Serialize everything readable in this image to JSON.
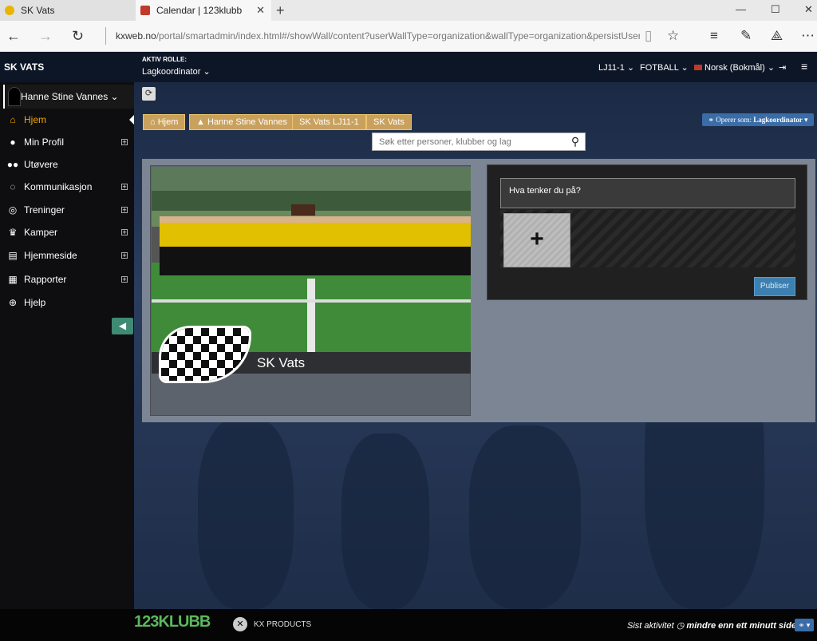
{
  "browser": {
    "tabs": [
      {
        "label": "SK Vats"
      },
      {
        "label": "Calendar | 123klubb"
      }
    ],
    "url_host": "kxweb.no",
    "url_path": "/portal/smartadmin/index.html#/showWall/content?userWallType=organization&wallType=organization&persistUser=fals"
  },
  "header": {
    "brand": "SK VATS",
    "role_label": "AKTIV ROLLE:",
    "role_value": "Lagkoordinator",
    "menu_team": "LJ11-1",
    "menu_sport": "FOTBALL",
    "menu_language": "Norsk (Bokmål)"
  },
  "sidebar": {
    "user_name": "Hanne Stine Vannes",
    "items": [
      {
        "label": "Hjem",
        "icon": "home-icon"
      },
      {
        "label": "Min Profil",
        "icon": "user-icon"
      },
      {
        "label": "Utøvere",
        "icon": "users-icon"
      },
      {
        "label": "Kommunikasjon",
        "icon": "comments-icon"
      },
      {
        "label": "Treninger",
        "icon": "target-icon"
      },
      {
        "label": "Kamper",
        "icon": "trophy-icon"
      },
      {
        "label": "Hjemmeside",
        "icon": "page-icon"
      },
      {
        "label": "Rapporter",
        "icon": "map-icon"
      },
      {
        "label": "Hjelp",
        "icon": "lifebuoy-icon"
      }
    ]
  },
  "breadcrumbs": [
    "Hjem",
    "Hanne Stine Vannes",
    "SK Vats LJ11-1",
    "SK Vats"
  ],
  "operate_as": {
    "label": "Operer som:",
    "value": "Lagkoordinator"
  },
  "search": {
    "placeholder": "Søk etter personer, klubber og lag"
  },
  "club": {
    "name": "SK Vats"
  },
  "post": {
    "placeholder": "Hva tenker du på?",
    "publish_label": "Publiser",
    "add_label": "+"
  },
  "footer": {
    "logo_text": "123KLUBB",
    "kx_text": "KX PRODUCTS",
    "last_active_prefix": "Sist aktivitet",
    "last_active_value": "mindre enn ett minutt siden"
  },
  "colors": {
    "accent": "#f5a800",
    "crumb": "#c9a15c",
    "publish": "#3c7fb1",
    "brand_green": "#5ab95c"
  }
}
